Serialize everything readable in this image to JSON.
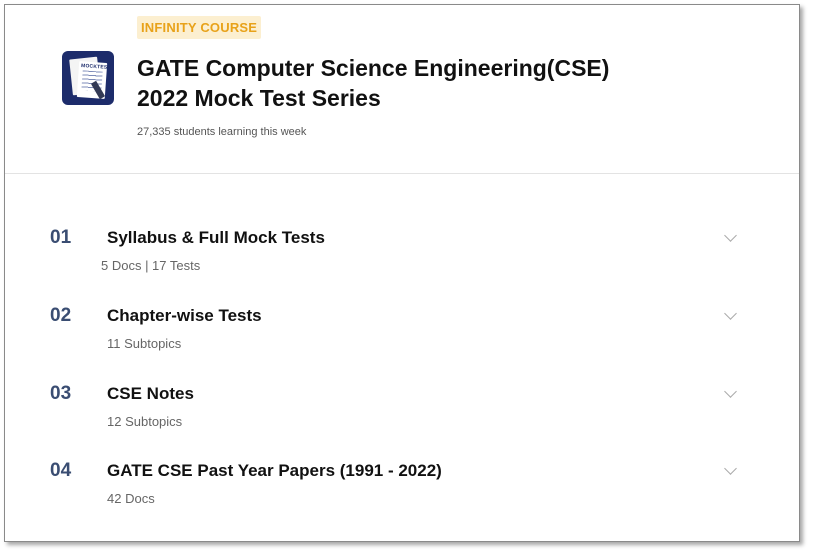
{
  "course": {
    "badge": "INFINITY COURSE",
    "title_line1": "GATE Computer Science Engineering(CSE)",
    "title_line2": "2022 Mock Test Series",
    "learners": "27,335 students learning this week",
    "thumbnail_label": "MOCKTEST"
  },
  "colors": {
    "badge_text": "#e8a21a",
    "badge_bg": "#fcefd0",
    "number": "#3a4d72",
    "thumb_bg": "#1d2c6b"
  },
  "chapters": [
    {
      "number": "01",
      "title": "Syllabus & Full Mock Tests",
      "subtitle": "5 Docs | 17 Tests",
      "icon": "chevron-down-icon"
    },
    {
      "number": "02",
      "title": "Chapter-wise Tests",
      "subtitle": "11 Subtopics",
      "icon": "chevron-down-icon"
    },
    {
      "number": "03",
      "title": "CSE Notes",
      "subtitle": "12 Subtopics",
      "icon": "chevron-down-icon"
    },
    {
      "number": "04",
      "title": "GATE CSE Past Year Papers (1991 - 2022)",
      "subtitle": "42 Docs",
      "icon": "chevron-down-icon"
    }
  ]
}
